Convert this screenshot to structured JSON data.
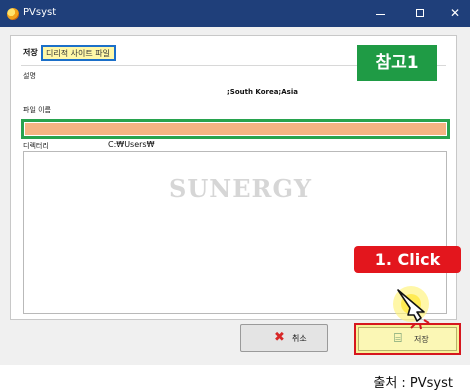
{
  "window": {
    "title": "PVsyst",
    "minimize_glyph": "",
    "maximize_glyph": "",
    "close_glyph": "✕"
  },
  "form": {
    "save_label": "저장",
    "site_file_tag": "디리적 사이트 파일",
    "description_label": "설명",
    "description_value": ";South Korea;Asia",
    "file_name_label": "파일 이름",
    "file_name_value": "",
    "directory_label": "디렉터리",
    "directory_value": "C:₩Users₩"
  },
  "file_list": {
    "watermark": "SUNERGY"
  },
  "buttons": {
    "cancel_label": "취소",
    "save_label": "저장"
  },
  "annotations": {
    "reference_badge": "참고1",
    "click_callout": "1. Click"
  },
  "caption": "출처 : PVsyst",
  "colors": {
    "titlebar": "#1f3f7a",
    "badge_green": "#1f9b45",
    "callout_red": "#e3161d",
    "file_name_fill": "#f4b483",
    "tag_border": "#1b6fc9"
  }
}
